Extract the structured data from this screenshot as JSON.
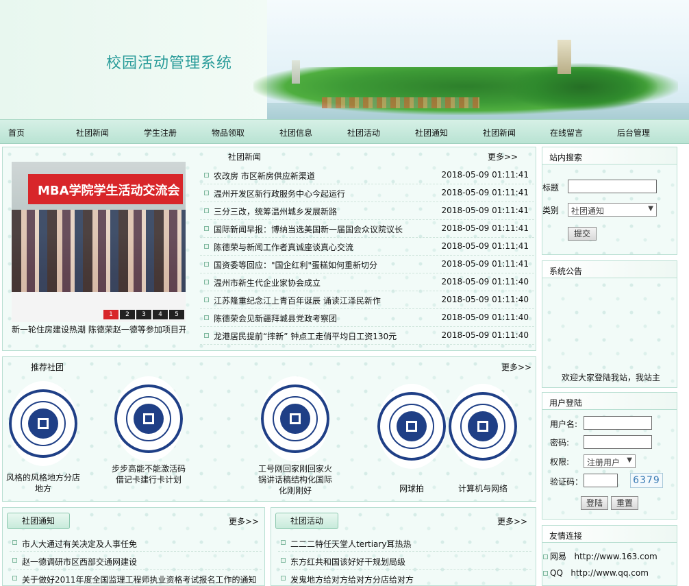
{
  "header": {
    "title": "校园活动管理系统"
  },
  "nav": [
    "首页",
    "社团新闻",
    "学生注册",
    "物品领取",
    "社团信息",
    "社团活动",
    "社团通知",
    "社团新闻",
    "在线留言",
    "后台管理"
  ],
  "news": {
    "title": "社团新闻",
    "more": "更多>>",
    "photo_banner_text": "MBA学院学生活动交流会",
    "photo_caption": "新一轮住房建设热潮 陈德荣赵一德等参加项目开工",
    "photo_pager": [
      "1",
      "2",
      "3",
      "4",
      "5"
    ],
    "items": [
      {
        "title": "农改房 市区新房供应新渠道",
        "date": "2018-05-09 01:11:41"
      },
      {
        "title": "温州开发区新行政服务中心今起运行",
        "date": "2018-05-09 01:11:41"
      },
      {
        "title": "三分三改，统筹温州城乡发展新路",
        "date": "2018-05-09 01:11:41"
      },
      {
        "title": "国际新闻早报：博纳当选美国新一届国会众议院议长",
        "date": "2018-05-09 01:11:41"
      },
      {
        "title": "陈德荣与新闻工作者真诚座谈真心交流",
        "date": "2018-05-09 01:11:41"
      },
      {
        "title": "国资委等回应：\"国企红利\"蛋糕如何重新切分",
        "date": "2018-05-09 01:11:41"
      },
      {
        "title": "温州市新生代企业家协会成立",
        "date": "2018-05-09 01:11:40"
      },
      {
        "title": "江苏隆重纪念江上青百年诞辰 诵读江泽民新作",
        "date": "2018-05-09 01:11:40"
      },
      {
        "title": "陈德荣会见新疆拜城县党政考察团",
        "date": "2018-05-09 01:11:40"
      },
      {
        "title": "龙港居民提前“摔新” 钟点工走俏平均日工资130元",
        "date": "2018-05-09 01:11:40"
      }
    ]
  },
  "recommended": {
    "title": "推荐社团",
    "more": "更多>>",
    "clubs": [
      {
        "name": "风格的风格地方分店地方"
      },
      {
        "name": "步步高能不能激活码借记卡建行卡计划"
      },
      {
        "name": "工号刚回家刚回家火锅讲话稿结构化国际化刚刚好"
      },
      {
        "name": "网球拍"
      },
      {
        "name": "计算机与网络"
      }
    ]
  },
  "notices": {
    "tab": "社团通知",
    "more": "更多>>",
    "items": [
      "市人大通过有关决定及人事任免",
      "赵一德调研市区西部交通网建设",
      "关于做好2011年度全国监理工程师执业资格考试报名工作的通知"
    ]
  },
  "activities": {
    "tab": "社团活动",
    "more": "更多>>",
    "items": [
      "二二二特任天堂人tertiary耳热热",
      "东方红共和国该好好干规划局级",
      "发鬼地方给对方给对方分店给对方"
    ]
  },
  "search": {
    "head": "站内搜索",
    "label_title": "标题",
    "label_category": "类别",
    "category_value": "社团通知",
    "submit": "提交"
  },
  "announcement": {
    "head": "系统公告",
    "text": "欢迎大家登陆我站，我站主"
  },
  "login": {
    "head": "用户登陆",
    "username_label": "用户名:",
    "password_label": "密码:",
    "role_label": "权限:",
    "role_value": "注册用户",
    "captcha_label": "验证码：",
    "captcha_value": "6379",
    "login_button": "登陆",
    "reset_button": "重置"
  },
  "links": {
    "head": "友情连接",
    "items": [
      {
        "name": "网易",
        "url": "http://www.163.com"
      },
      {
        "name": "QQ",
        "url": "http://www.qq.com"
      }
    ]
  }
}
